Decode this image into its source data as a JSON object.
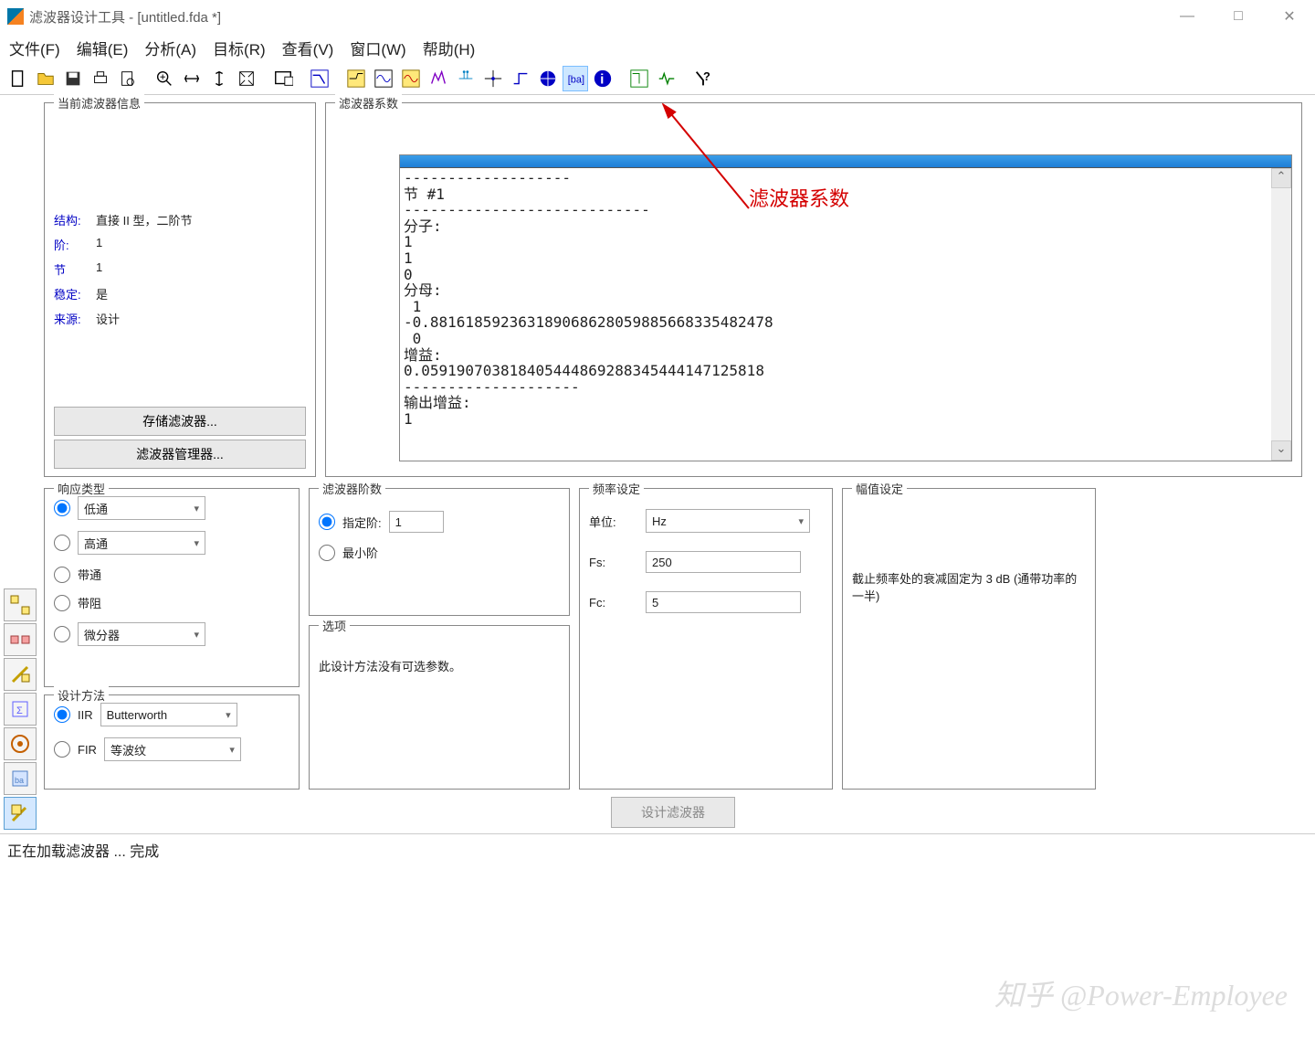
{
  "window": {
    "title": "滤波器设计工具 -  [untitled.fda *]",
    "min": "—",
    "max": "□",
    "close": "✕"
  },
  "menu": {
    "file": "文件(F)",
    "edit": "编辑(E)",
    "analyze": "分析(A)",
    "target": "目标(R)",
    "view": "查看(V)",
    "window": "窗口(W)",
    "help": "帮助(H)"
  },
  "toolbar_icons": {
    "new": "new-file-icon",
    "open": "open-folder-icon",
    "save": "save-icon",
    "print": "print-icon",
    "preview": "print-preview-icon",
    "zoomin": "zoom-in-icon",
    "zoomfit": "zoom-fit-icon",
    "zoomy": "zoom-y-icon",
    "zoomfull": "zoom-full-icon",
    "newscope": "scope-icon",
    "magnitude": "magnitude-icon",
    "phase": "phase-icon",
    "impulse": "impulse-icon",
    "step": "step-icon",
    "polezero": "pole-zero-icon",
    "groupdelay": "group-delay-icon",
    "sos": "sos-icon",
    "roundoff": "roundoff-icon",
    "target": "target-icon",
    "coeff": "coefficients-icon",
    "info": "info-icon",
    "fopt": "filter-opt-icon",
    "msig": "model-sig-icon",
    "whatsthis": "whats-this-icon"
  },
  "info_panel": {
    "title": "当前滤波器信息",
    "rows": {
      "struct_label": "结构:",
      "struct_val": "直接 II 型，二阶节",
      "order_label": "阶:",
      "order_val": "1",
      "sect_label": "节",
      "sect_val": "1",
      "stable_label": "稳定:",
      "stable_val": "是",
      "source_label": "来源:",
      "source_val": "设计"
    },
    "store_btn": "存储滤波器...",
    "manager_btn": "滤波器管理器..."
  },
  "coeff_panel": {
    "title": "滤波器系数",
    "text": "-------------------\n节 #1\n----------------------------\n分子:\n1\n1\n0\n分母:\n 1\n-0.881618592363189068628059885668335482478\n 0\n增益:\n0.059190703818405444869288345444147125818\n--------------------\n输出增益:\n1"
  },
  "resp": {
    "title": "响应类型",
    "lp": "低通",
    "hp": "高通",
    "bp": "带通",
    "bs": "带阻",
    "diff": "微分器"
  },
  "design": {
    "title": "设计方法",
    "iir": "IIR",
    "iir_method": "Butterworth",
    "fir": "FIR",
    "fir_method": "等波纹"
  },
  "order": {
    "title": "滤波器阶数",
    "specify": "指定阶:",
    "specify_val": "1",
    "minimum": "最小阶"
  },
  "options": {
    "title": "选项",
    "msg": "此设计方法没有可选参数。"
  },
  "freq": {
    "title": "频率设定",
    "unit_label": "单位:",
    "unit_val": "Hz",
    "fs_label": "Fs:",
    "fs_val": "250",
    "fc_label": "Fc:",
    "fc_val": "5"
  },
  "mag": {
    "title": "幅值设定",
    "msg": "截止频率处的衰减固定为 3 dB (通带功率的一半)"
  },
  "design_btn": "设计滤波器",
  "status": "正在加载滤波器 ... 完成",
  "annotation": "滤波器系数",
  "watermark": "知乎 @Power-Employee"
}
